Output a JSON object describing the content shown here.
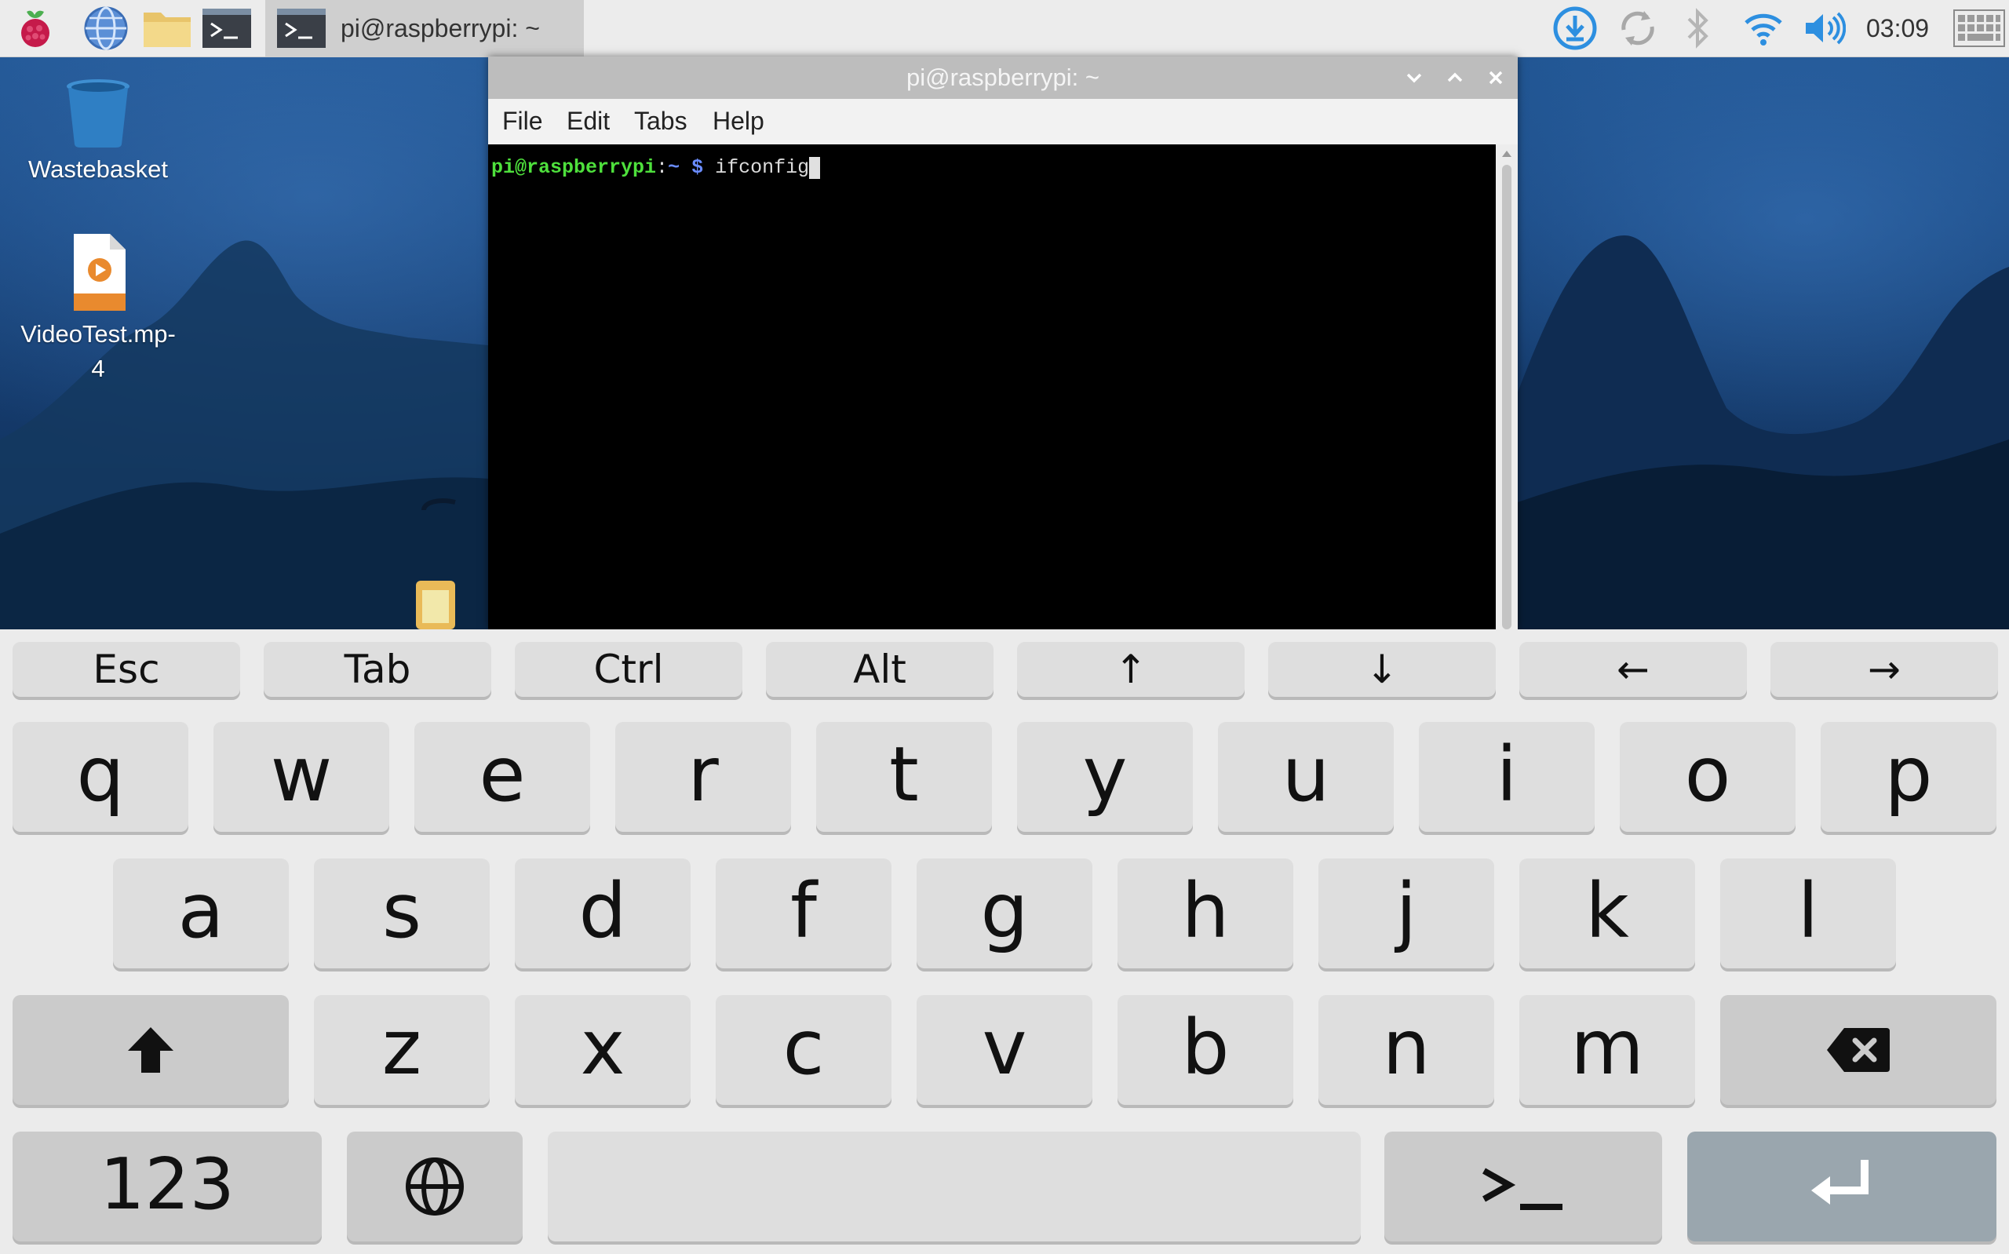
{
  "taskbar": {
    "launchers": [
      "raspberry-menu",
      "web-browser",
      "file-manager",
      "terminal"
    ],
    "task_title": "pi@raspberrypi: ~",
    "clock": "03:09",
    "tray_icons": [
      "download-icon",
      "sync-icon",
      "bluetooth-icon",
      "wifi-icon",
      "volume-icon",
      "keyboard-icon"
    ]
  },
  "desktop": {
    "icons": [
      {
        "label": "Wastebasket",
        "icon": "trash-icon"
      },
      {
        "label_line1": "VideoTest.mp-",
        "label_line2": "4",
        "icon": "video-file-icon"
      }
    ]
  },
  "terminal": {
    "title": "pi@raspberrypi: ~",
    "menu": [
      "File",
      "Edit",
      "Tabs",
      "Help"
    ],
    "prompt": {
      "user_host": "pi@raspberrypi",
      "sep": ":",
      "dir": "~",
      "dollar": " $ "
    },
    "command": "ifconfig"
  },
  "keyboard": {
    "function_row": [
      "Esc",
      "Tab",
      "Ctrl",
      "Alt",
      "↑",
      "↓",
      "←",
      "→"
    ],
    "row1": [
      "q",
      "w",
      "e",
      "r",
      "t",
      "y",
      "u",
      "i",
      "o",
      "p"
    ],
    "row2": [
      "a",
      "s",
      "d",
      "f",
      "g",
      "h",
      "j",
      "k",
      "l"
    ],
    "row3": [
      "z",
      "x",
      "c",
      "v",
      "b",
      "n",
      "m"
    ],
    "bottom": {
      "numbers": "123",
      "terminal": ">_",
      "space": ""
    }
  },
  "colors": {
    "taskbar_bg": "#ececec",
    "terminal_bg": "#000000",
    "prompt_user": "#4ee03c",
    "prompt_dir": "#6a8cff",
    "keyboard_bg": "#ebebeb",
    "key_bg": "#dedede",
    "enter_key_bg": "#9aa6ae"
  }
}
